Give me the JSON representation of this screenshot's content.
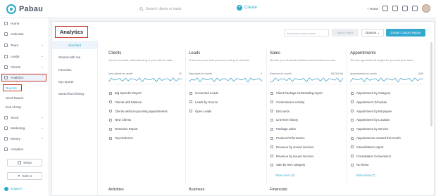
{
  "app": {
    "logo_text": "Pabau"
  },
  "header": {
    "search_placeholder": "Search clients or leads",
    "create_label": "Create",
    "home_label": "+ Home"
  },
  "sidebar": {
    "items": [
      {
        "label": "Home",
        "chev": ""
      },
      {
        "label": "Calendar",
        "chev": ""
      },
      {
        "label": "Team",
        "chev": "⌄"
      },
      {
        "label": "Leads",
        "chev": "⌄"
      },
      {
        "label": "Clients",
        "chev": "⌄"
      },
      {
        "label": "Analytics",
        "chev": "⌃"
      }
    ],
    "sub_items": [
      "Reports",
      "Send Report",
      "End of Day"
    ],
    "lower_items": [
      {
        "label": "Stock",
        "chev": "⌄"
      },
      {
        "label": "Marketing",
        "chev": "⌄"
      },
      {
        "label": "Money",
        "chev": "⌄"
      },
      {
        "label": "Activities",
        "chev": ""
      }
    ],
    "setup_label": "Setup",
    "edit_ai_label": "Edit AI",
    "support_label": "Support"
  },
  "page": {
    "title": "Analytics",
    "report_search_placeholder": "Search by report name",
    "filters_label": "Select Filters",
    "options_label": "Options ⌄",
    "create_report_label": "Create Custom Report"
  },
  "subnav": [
    "Standard",
    "Shared with me",
    "Favorites",
    "My reports",
    "Saved from library"
  ],
  "columns": [
    {
      "title": "Clients",
      "desc": "Get an accurate understanding of your client's data",
      "spark_label": "New clients for month",
      "spark_value": "87",
      "reports": [
        "Big Spender Report",
        "Clients with balance",
        "Clients without upcoming appointments",
        "New Clients",
        "Retention Report",
        "Top Referrers"
      ],
      "show_more": ""
    },
    {
      "title": "Leads",
      "desc": "Track how your lead process is doing at all times",
      "spark_label": "New leads for month",
      "spark_value": "0",
      "reports": [
        "Converted Leads",
        "Leads by Source",
        "Open Leads"
      ],
      "show_more": ""
    },
    {
      "title": "Sales",
      "desc": "Monitor your financial activities and business income.",
      "spark_label": "Revenue for month",
      "spark_value": "$32306.66",
      "reports": [
        "Client Package Outstanding report",
        "Commissions Activity",
        "Discounts",
        "Line item history",
        "Package sales",
        "Product Performance",
        "Revenue by closed invoices",
        "Revenue by issued invoices",
        "Sale by item category"
      ],
      "show_more": "Show more (2)"
    },
    {
      "title": "Appointments",
      "desc": "Get key appointment insight for you and your team",
      "spark_label": "Appointments by month",
      "spark_value": "1356",
      "reports": [
        "Appointment by Category",
        "Appointment Schedule",
        "Appointment by Employee",
        "Appointment by Location",
        "Appointment by Service",
        "Appointments created this month",
        "Cancellations report",
        "Consultation Conversions",
        "No Show"
      ],
      "show_more": "Show more (7)"
    }
  ],
  "bottom_columns": [
    "Activities",
    "Business",
    "Financials"
  ]
}
